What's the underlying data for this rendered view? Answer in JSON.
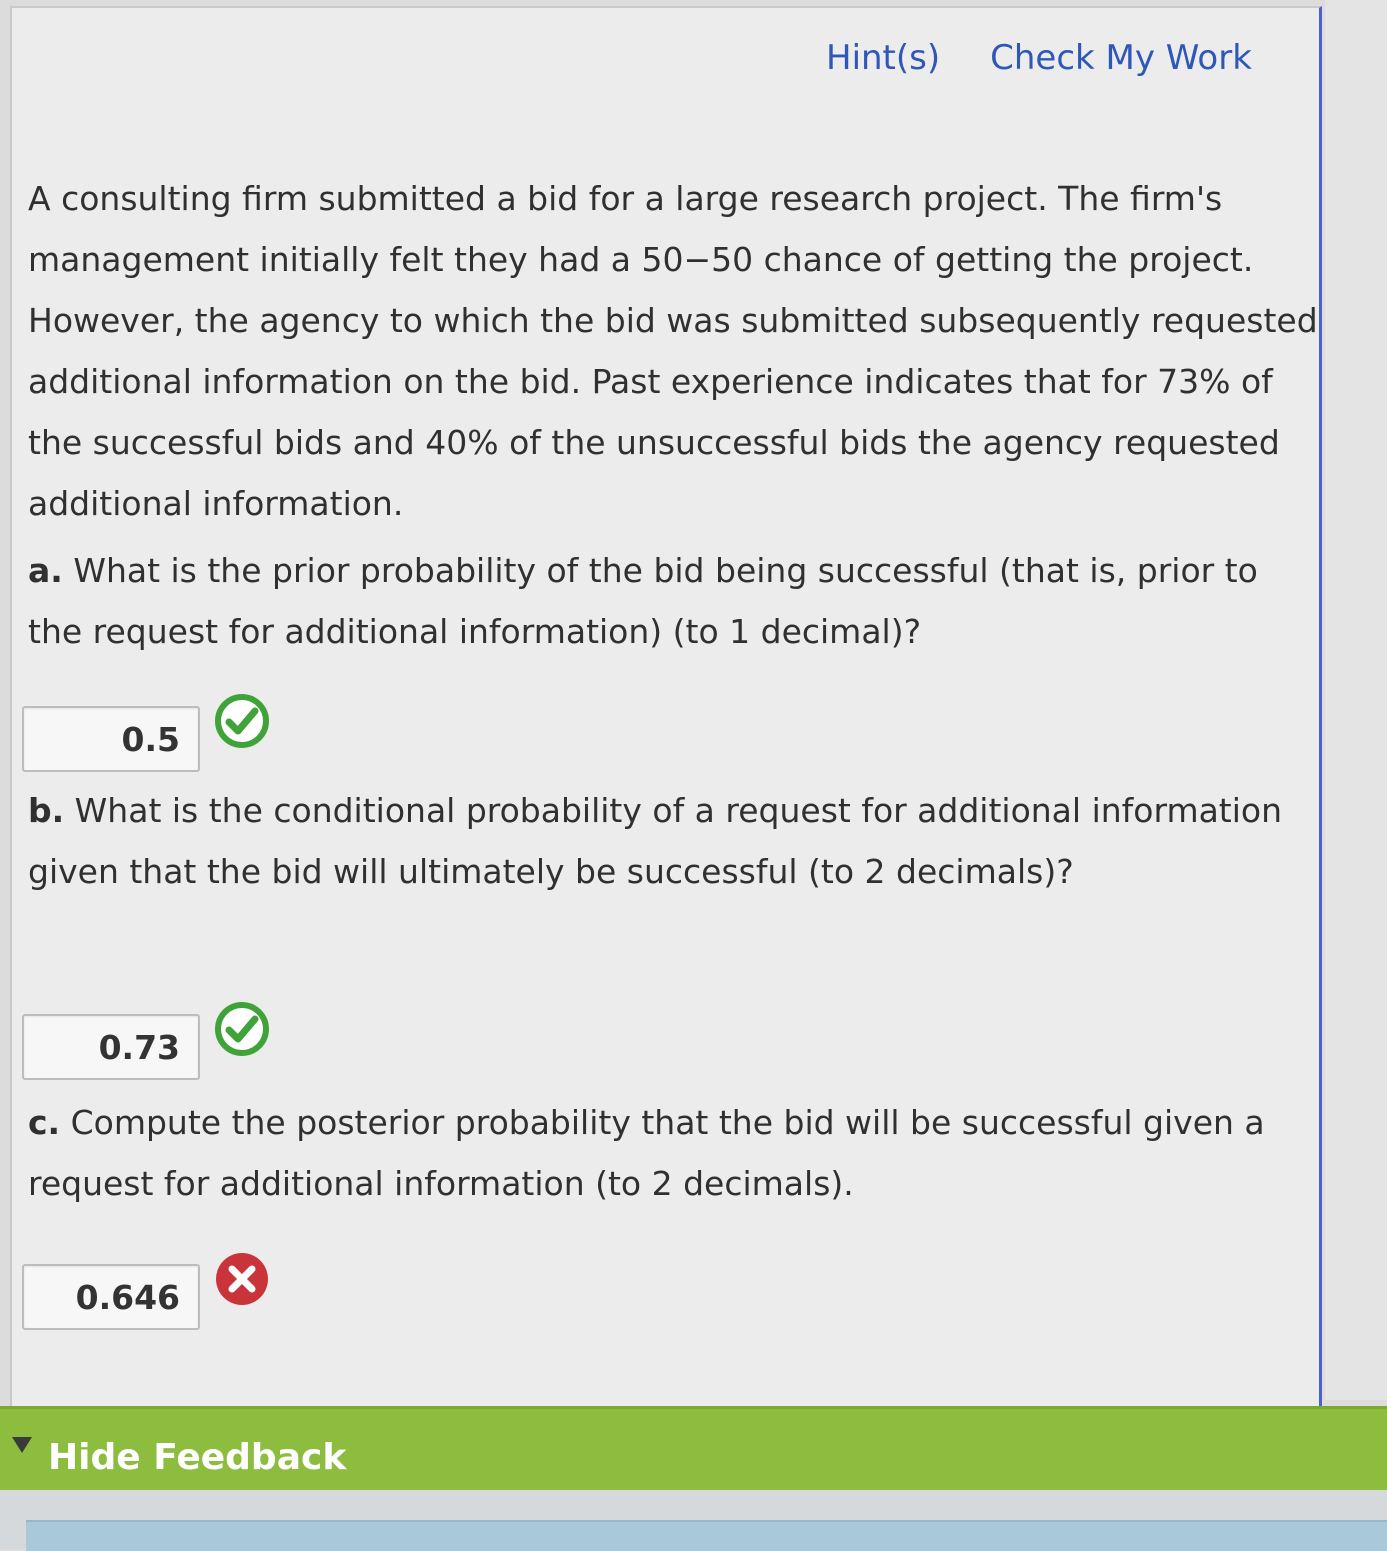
{
  "toolbar": {
    "hints_label": "Hint(s)",
    "check_label": "Check My Work"
  },
  "problem": {
    "text": "A consulting firm submitted a bid for a large research project. The firm's management initially felt they had a 50−50 chance of getting the project. However, the agency to which the bid was submitted subsequently requested additional information on the bid. Past experience indicates that for 73% of the successful bids and 40% of the unsuccessful bids the agency requested additional information."
  },
  "questions": [
    {
      "label": "a.",
      "text": "What is the prior probability of the bid being successful (that is, prior to the request for additional information) (to 1 decimal)?",
      "answer": "0.5",
      "status": "correct"
    },
    {
      "label": "b.",
      "text": "What is the conditional probability of a request for additional information given that the bid will ultimately be successful (to 2 decimals)?",
      "answer": "0.73",
      "status": "correct"
    },
    {
      "label": "c.",
      "text": "Compute the posterior probability that the bid will be successful given a request for additional information (to 2 decimals).",
      "answer": "0.646",
      "status": "incorrect"
    }
  ],
  "feedback": {
    "toggle_label": "Hide Feedback"
  },
  "colors": {
    "link": "#2f57b8",
    "correct": "#3fa33a",
    "incorrect": "#c9343a",
    "feedback_bar": "#8cbd3f"
  }
}
